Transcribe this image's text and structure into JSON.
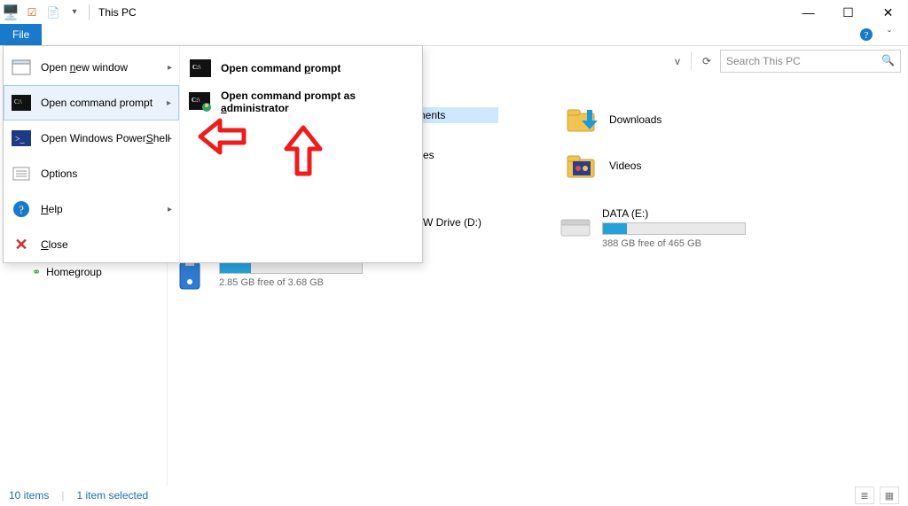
{
  "window": {
    "title": "This PC",
    "controls": {
      "min": "—",
      "max": "☐",
      "close": "✕"
    }
  },
  "tabs": {
    "file": "File"
  },
  "search": {
    "placeholder": "Search This PC"
  },
  "backstage": {
    "items": [
      {
        "id": "new-window",
        "label_pre": "Open ",
        "u": "n",
        "label_post": "ew window",
        "has_sub": true
      },
      {
        "id": "cmd",
        "label": "Open command prompt",
        "has_sub": true
      },
      {
        "id": "powershell",
        "label_pre": "Open Windows Power",
        "u": "S",
        "label_post": "hell",
        "has_sub": true
      },
      {
        "id": "options",
        "label": "Options"
      },
      {
        "id": "help",
        "u": "H",
        "label_post": "elp",
        "has_sub": true
      },
      {
        "id": "close",
        "u": "C",
        "label_post": "lose"
      }
    ],
    "submenu": {
      "title": "Open command prompt",
      "items": [
        {
          "id": "cmd-plain",
          "label_pre": "Open command ",
          "u": "p",
          "label_post": "rompt"
        },
        {
          "id": "cmd-admin",
          "label_pre": "Open command prompt as ",
          "u": "a",
          "label_post": "dministrator"
        }
      ]
    }
  },
  "sidebar": {
    "homegroup": "Homegroup"
  },
  "folders": {
    "documents": {
      "label_suffix": "nents"
    },
    "downloads": "Downloads",
    "videos": "Videos"
  },
  "drives": {
    "dvd": {
      "label_suffix": "W Drive (D:)"
    },
    "data": {
      "label": "DATA (E:)",
      "free": "388 GB free of 465 GB",
      "fill_pct": 17
    },
    "usb": {
      "free": "2.85 GB free of 3.68 GB",
      "fill_pct": 22
    }
  },
  "status": {
    "count": "10 items",
    "selected": "1 item selected"
  },
  "glyphs": {
    "monitor": "🖥️",
    "props": "☑",
    "doc": "📄",
    "dropdown": "▾",
    "help": "?",
    "chevron": "ˇ",
    "back": "◀",
    "refresh": "⟳",
    "addr_down": "v",
    "search": "🔍",
    "folder": "📁",
    "download": "⬇",
    "video": "🎞",
    "hdd": "▭",
    "usb": "💾",
    "homegroup": "⚭",
    "newwin": "▭",
    "cmd": "C:\\",
    "ps": ">_",
    "opts": "☰",
    "close_x": "✕",
    "arrow": "▸",
    "view_details": "≣",
    "view_tiles": "▦"
  }
}
